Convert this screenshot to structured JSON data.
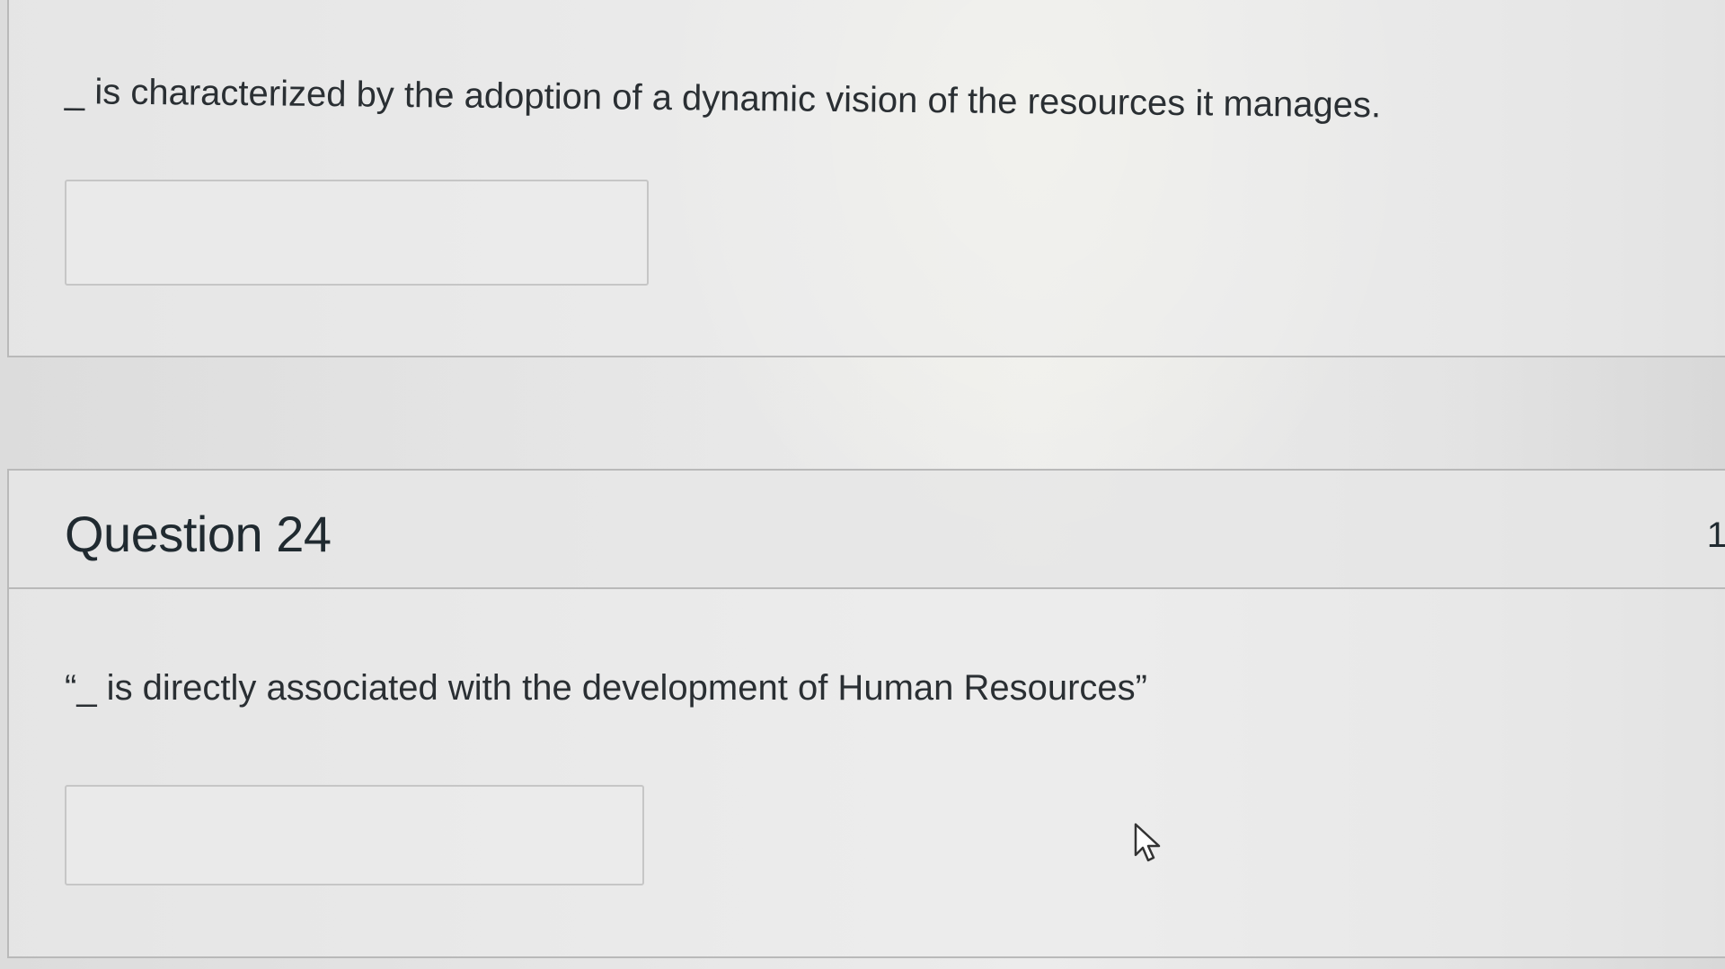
{
  "questions": [
    {
      "text": "_ is characterized by the adoption of a dynamic vision of the resources it manages.",
      "answer_value": ""
    },
    {
      "title": "Question 24",
      "points": "1",
      "text": "“_ is directly associated with the development of Human Resources”",
      "answer_value": ""
    }
  ],
  "icons": {
    "cursor": "mouse-pointer-icon"
  },
  "colors": {
    "background": "#e6e6e6",
    "border": "#b9b9b9",
    "text": "#2d3b45"
  }
}
